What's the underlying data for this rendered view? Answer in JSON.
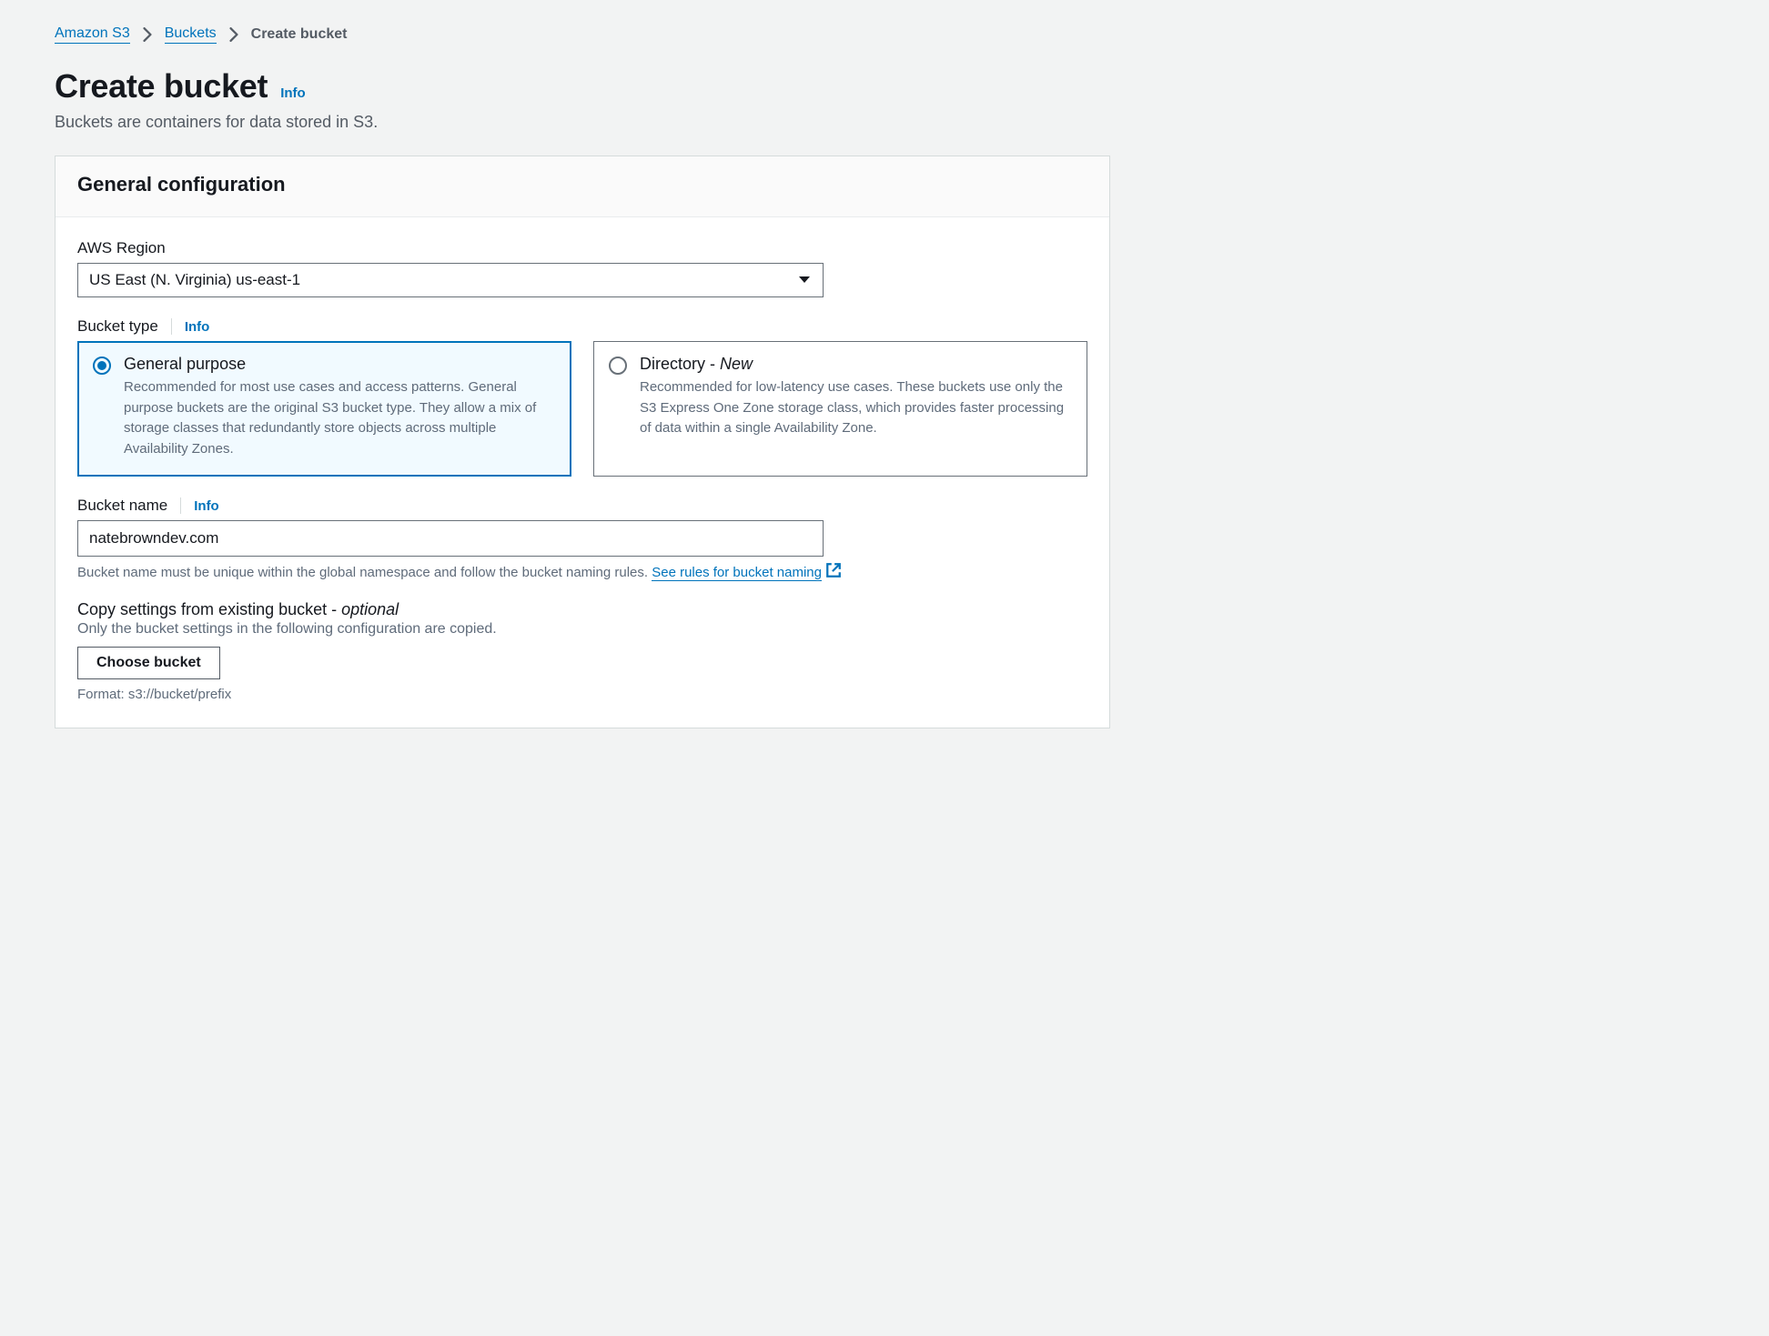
{
  "breadcrumb": {
    "root": "Amazon S3",
    "mid": "Buckets",
    "current": "Create bucket"
  },
  "page": {
    "title": "Create bucket",
    "info": "Info",
    "description": "Buckets are containers for data stored in S3."
  },
  "panel": {
    "title": "General configuration"
  },
  "region": {
    "label": "AWS Region",
    "value": "US East (N. Virginia) us-east-1"
  },
  "bucket_type": {
    "label": "Bucket type",
    "info": "Info",
    "options": {
      "general": {
        "title": "General purpose",
        "desc": "Recommended for most use cases and access patterns. General purpose buckets are the original S3 bucket type. They allow a mix of storage classes that redundantly store objects across multiple Availability Zones."
      },
      "directory": {
        "title_prefix": "Directory - ",
        "title_suffix": "New",
        "desc": "Recommended for low-latency use cases. These buckets use only the S3 Express One Zone storage class, which provides faster processing of data within a single Availability Zone."
      }
    }
  },
  "bucket_name": {
    "label": "Bucket name",
    "info": "Info",
    "value": "natebrowndev.com",
    "help_prefix": "Bucket name must be unique within the global namespace and follow the bucket naming rules. ",
    "help_link": "See rules for bucket naming"
  },
  "copy_settings": {
    "label_main": "Copy settings from existing bucket - ",
    "label_optional": "optional",
    "desc": "Only the bucket settings in the following configuration are copied.",
    "button": "Choose bucket",
    "format": "Format: s3://bucket/prefix"
  }
}
